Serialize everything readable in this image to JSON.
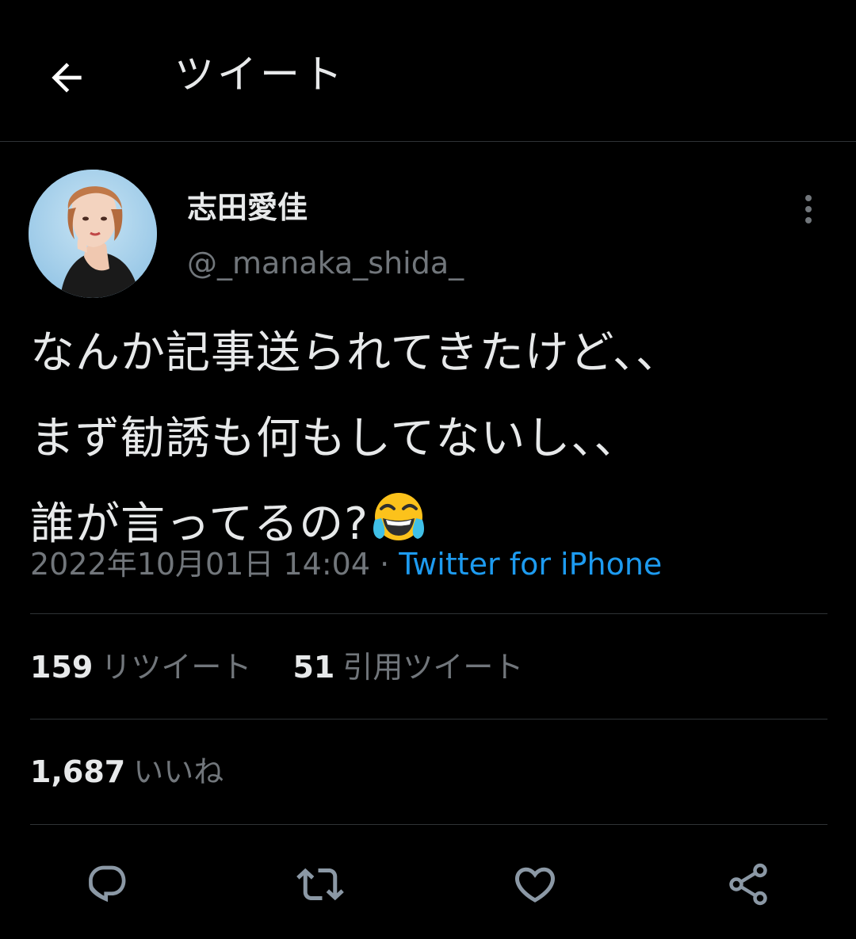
{
  "header": {
    "title": "ツイート",
    "back_icon": "arrow-left-icon"
  },
  "tweet": {
    "author": {
      "name": "志田愛佳",
      "handle": "@_manaka_shida_"
    },
    "text_lines": [
      "なんか記事送られてきたけど、、",
      "まず勧誘も何もしてないし、、",
      "誰が言ってるの?"
    ],
    "emoji": "face-with-tears-of-joy",
    "timestamp": "2022年10月01日 14:04",
    "separator": " · ",
    "source": "Twitter for iPhone"
  },
  "stats": {
    "retweets": {
      "count": "159",
      "label": "リツイート"
    },
    "quotes": {
      "count": "51",
      "label": "引用ツイート"
    },
    "likes": {
      "count": "1,687",
      "label": "いいね"
    }
  },
  "actions": [
    {
      "icon": "reply-icon"
    },
    {
      "icon": "retweet-icon"
    },
    {
      "icon": "like-heart-icon"
    },
    {
      "icon": "share-icon"
    }
  ],
  "colors": {
    "background": "#000000",
    "text_primary": "#e7e9ea",
    "text_secondary": "#71767b",
    "link_accent": "#1d9bf0",
    "divider": "#2f3336"
  }
}
